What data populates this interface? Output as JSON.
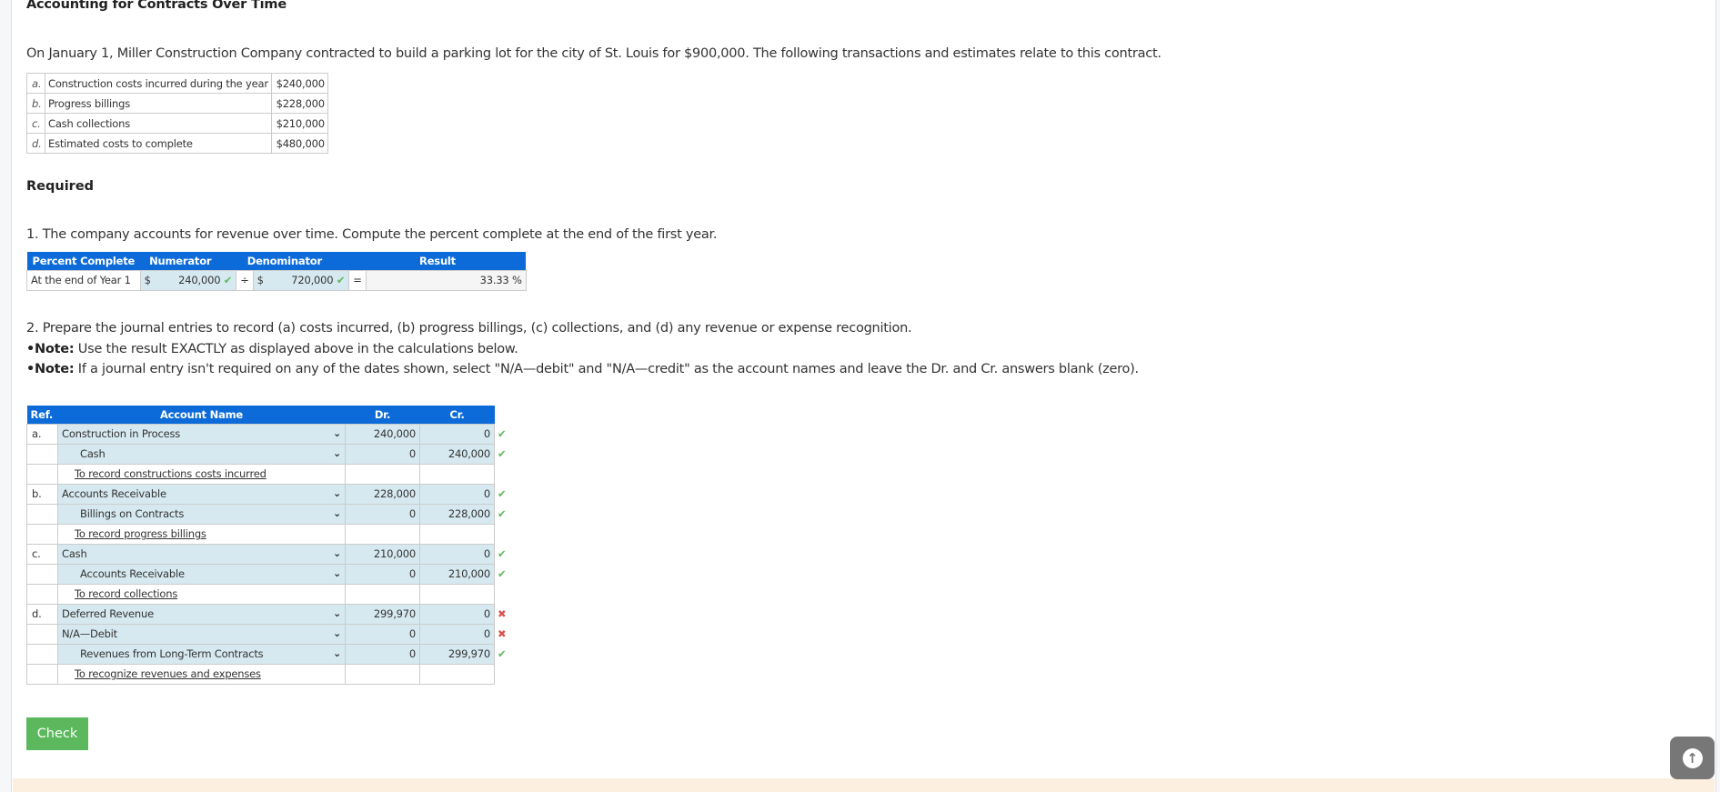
{
  "title": "Accounting for Contracts Over Time",
  "intro": "On January 1, Miller Construction Company contracted to build a parking lot for the city of St. Louis for $900,000. The following transactions and estimates relate to this contract.",
  "given": [
    {
      "ref": "a.",
      "label": "Construction costs incurred during the year",
      "amount": "$240,000"
    },
    {
      "ref": "b.",
      "label": "Progress billings",
      "amount": "$228,000"
    },
    {
      "ref": "c.",
      "label": "Cash collections",
      "amount": "$210,000"
    },
    {
      "ref": "d.",
      "label": "Estimated costs to complete",
      "amount": "$480,000"
    }
  ],
  "required_heading": "Required",
  "q1": "1. The company accounts for revenue over time. Compute the percent complete at the end of the first year.",
  "percent_table": {
    "headers": [
      "Percent Complete",
      "Numerator",
      "Denominator",
      "Result"
    ],
    "row_label": "At the end of Year 1",
    "currency": "$",
    "numerator": "240,000",
    "divide": "÷",
    "denominator": "720,000",
    "equals": "=",
    "result": "33.33 %"
  },
  "q2": {
    "line1": "2. Prepare the journal entries to record (a) costs incurred, (b) progress billings, (c) collections, and (d) any revenue or expense recognition.",
    "note_bullet": "•",
    "note_label": "Note:",
    "note1": " Use the result EXACTLY as displayed above in the calculations below.",
    "note2": " If a journal entry isn't required on any of the dates shown, select \"N/A—debit\" and \"N/A—credit\" as the account names and leave the Dr. and Cr. answers blank (zero)."
  },
  "journal": {
    "headers": [
      "Ref.",
      "Account Name",
      "Dr.",
      "Cr."
    ],
    "rows": [
      {
        "ref": "a.",
        "account": "Construction in Process",
        "dr": "240,000",
        "cr": "0",
        "status": "correct"
      },
      {
        "ref": "",
        "account": "Cash",
        "dr": "0",
        "cr": "240,000",
        "status": "correct"
      },
      {
        "ref": "",
        "desc": "To record constructions costs incurred"
      },
      {
        "ref": "b.",
        "account": "Accounts Receivable",
        "dr": "228,000",
        "cr": "0",
        "status": "correct"
      },
      {
        "ref": "",
        "account": "Billings on Contracts",
        "dr": "0",
        "cr": "228,000",
        "status": "correct"
      },
      {
        "ref": "",
        "desc": "To record progress billings"
      },
      {
        "ref": "c.",
        "account": "Cash",
        "dr": "210,000",
        "cr": "0",
        "status": "correct"
      },
      {
        "ref": "",
        "account": "Accounts Receivable",
        "dr": "0",
        "cr": "210,000",
        "status": "correct"
      },
      {
        "ref": "",
        "desc": "To record collections"
      },
      {
        "ref": "d.",
        "account": "Deferred Revenue",
        "dr": "299,970",
        "cr": "0",
        "status": "incorrect"
      },
      {
        "ref": "",
        "account": "N/A—Debit",
        "dr": "0",
        "cr": "0",
        "status": "incorrect"
      },
      {
        "ref": "",
        "account": "Revenues from Long-Term Contracts",
        "dr": "0",
        "cr": "299,970",
        "status": "correct"
      },
      {
        "ref": "",
        "desc": "To recognize revenues and expenses"
      }
    ]
  },
  "icons": {
    "correct": "✔",
    "incorrect": "✖",
    "chevron": "⌄",
    "scroll_up": "↑"
  },
  "check_button": "Check",
  "colors": {
    "header_blue": "#0c6bd8",
    "input_blue": "#d6e9f0",
    "check_green": "#5cb85c",
    "error_red": "#d9534f"
  }
}
